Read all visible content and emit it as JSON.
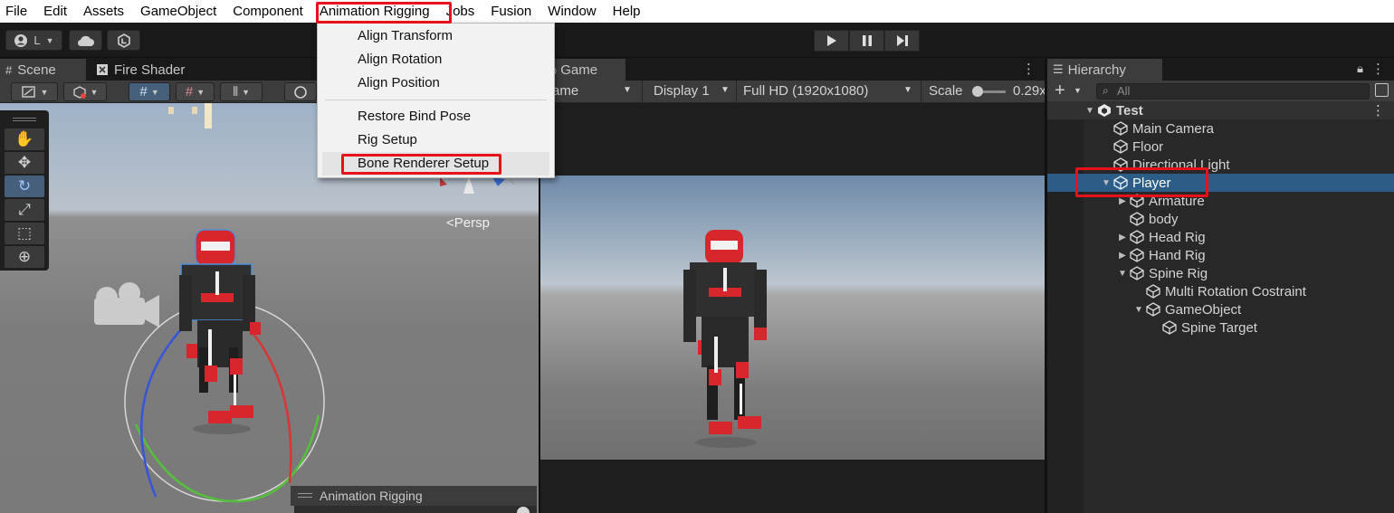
{
  "menubar": {
    "items": [
      "File",
      "Edit",
      "Assets",
      "GameObject",
      "Component",
      "Animation Rigging",
      "Jobs",
      "Fusion",
      "Window",
      "Help"
    ]
  },
  "toolbar": {
    "account_label": "L"
  },
  "dropdown": {
    "items": [
      "Align Transform",
      "Align Rotation",
      "Align Position",
      "Restore Bind Pose",
      "Rig Setup",
      "Bone Renderer Setup"
    ]
  },
  "scene": {
    "tabs": [
      "Scene",
      "Fire Shader"
    ],
    "persp_label": "<Persp",
    "overlay_title": "Animation Rigging"
  },
  "game": {
    "tab": "Game",
    "mode_label": "ame",
    "display": "Display 1",
    "resolution": "Full HD (1920x1080)",
    "scale_label": "Scale",
    "scale_value": "0.29x"
  },
  "hierarchy": {
    "tab": "Hierarchy",
    "search_placeholder": "All",
    "scene_name": "Test",
    "rows": [
      {
        "label": "Main Camera"
      },
      {
        "label": "Floor"
      },
      {
        "label": "Directional Light"
      },
      {
        "label": "Player"
      },
      {
        "label": "Armature"
      },
      {
        "label": "body"
      },
      {
        "label": "Head Rig"
      },
      {
        "label": "Hand Rig"
      },
      {
        "label": "Spine Rig"
      },
      {
        "label": "Multi Rotation Costraint"
      },
      {
        "label": "GameObject"
      },
      {
        "label": "Spine Target"
      }
    ]
  },
  "colors": {
    "highlight": "#e8101a",
    "selection": "#2c5d87",
    "panel_bg": "#282828"
  }
}
